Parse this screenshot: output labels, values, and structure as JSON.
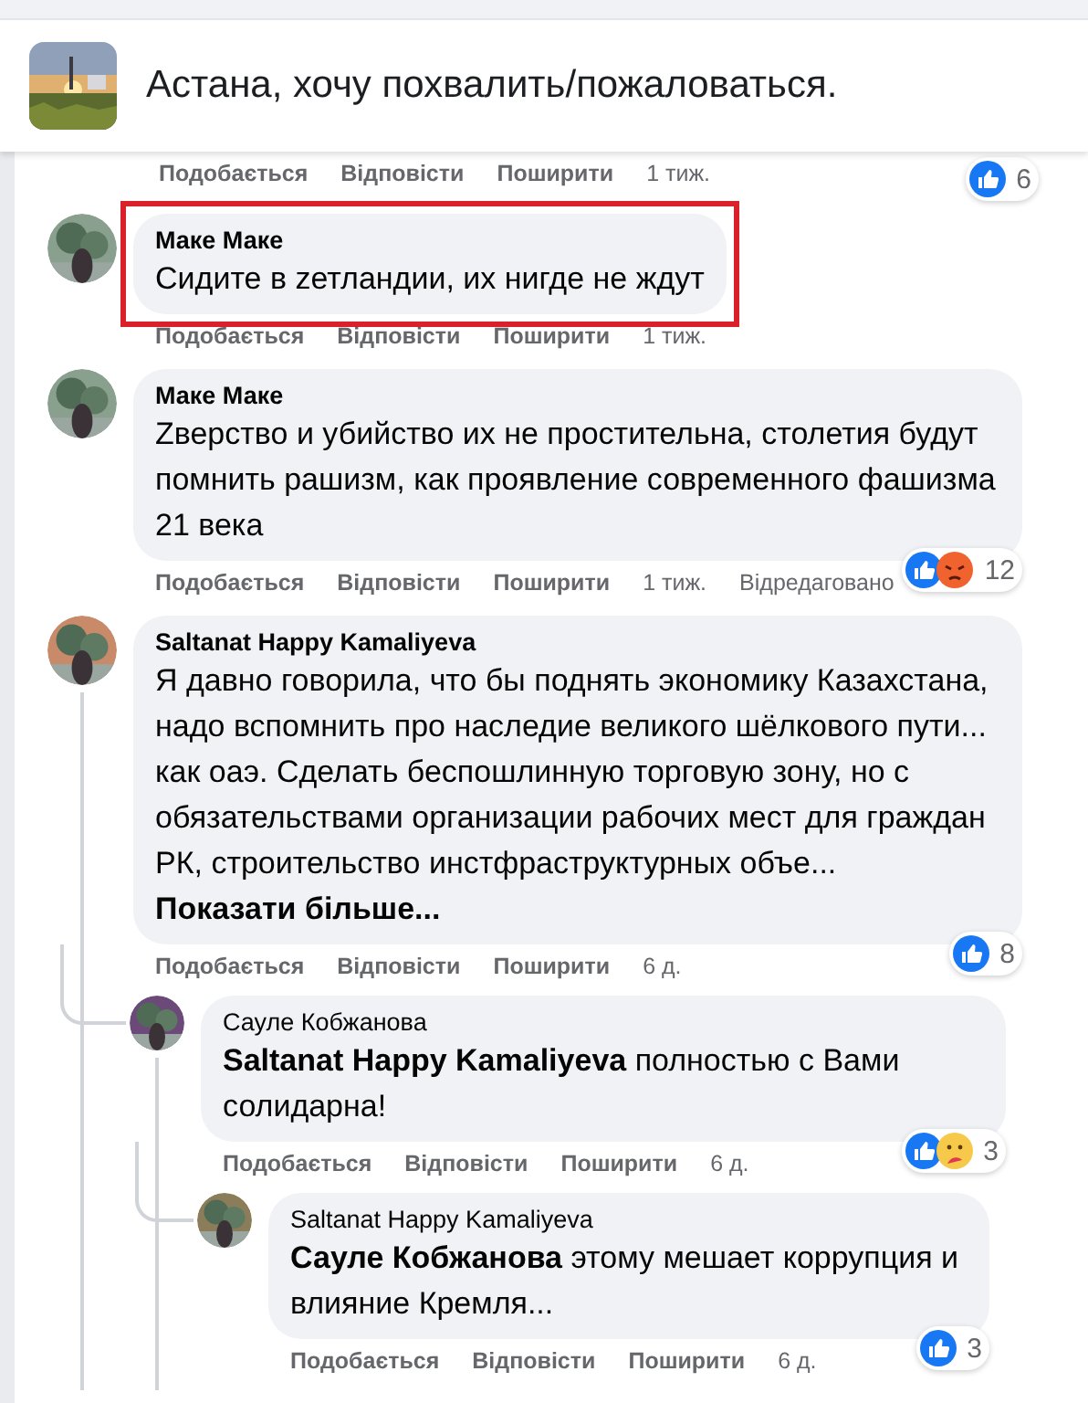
{
  "header": {
    "title": "Астана, хочу похвалить/пожаловаться."
  },
  "previous_actions": {
    "actions": [
      "Подобається",
      "Відповісти",
      "Поширити"
    ],
    "time": "1 тиж.",
    "reactions": {
      "icons": [
        {
          "kind": "like"
        }
      ],
      "count": "6"
    }
  },
  "comments": [
    {
      "author": "Маке Маке",
      "text": "Сидите в zетландии, их нигде не ждут",
      "highlighted": true,
      "actions": [
        "Подобається",
        "Відповісти",
        "Поширити"
      ],
      "time": "1 тиж."
    },
    {
      "author": "Маке Маке",
      "text": "Zверство и убийство их не простительна, столетия будут помнить рашизм, как проявление современного фашизма 21 века",
      "highlighted": false,
      "reactions": {
        "icons": [
          {
            "kind": "like"
          },
          {
            "kind": "angry"
          }
        ],
        "count": "12"
      },
      "actions": [
        "Подобається",
        "Відповісти",
        "Поширити"
      ],
      "time": "1 тиж.",
      "edited": "Відредаговано"
    },
    {
      "author": "Saltanat Happy Kamaliyeva",
      "text": "Я давно говорила, что бы поднять экономику Казахстана, надо вспомнить про наследие великого шёлкового пути... как оаэ. Сделать беспошлинную торговую зону, но с обязательствами организации рабочих мест для граждан РК, строительство инстфраструктурных объе...",
      "see_more": "Показати більше...",
      "highlighted": false,
      "reactions": {
        "icons": [
          {
            "kind": "like"
          }
        ],
        "count": "8"
      },
      "actions": [
        "Подобається",
        "Відповісти",
        "Поширити"
      ],
      "time": "6 д.",
      "children": [
        {
          "author": "Сауле Кобжанова",
          "text": "**Saltanat Happy Kamaliyeva** полностью с Вами солидарна!",
          "highlighted": false,
          "reactions": {
            "icons": [
              {
                "kind": "like"
              },
              {
                "kind": "care"
              }
            ],
            "count": "3"
          },
          "actions": [
            "Подобається",
            "Відповісти",
            "Поширити"
          ],
          "time": "6 д.",
          "children": [
            {
              "author": "Saltanat Happy Kamaliyeva",
              "text": "**Сауле Кобжанова** этому мешает коррупция и влияние Кремля...",
              "highlighted": false,
              "reactions": {
                "icons": [
                  {
                    "kind": "like"
                  }
                ],
                "count": "3"
              },
              "actions": [
                "Подобається",
                "Відповісти",
                "Поширити"
              ],
              "time": "6 д."
            }
          ]
        }
      ]
    }
  ]
}
